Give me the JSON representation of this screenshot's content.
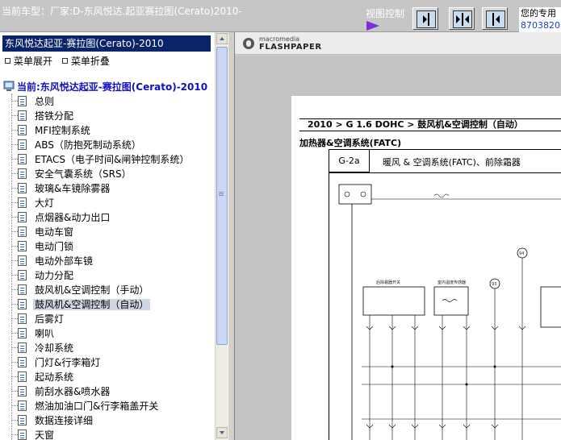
{
  "top_bar": {
    "title": "当前车型：厂家:D-东风悦达.起亚赛拉图(Cerato)2010-",
    "view_control_label": "视图控制",
    "right_info_line1": "您的专用",
    "right_info_line2": "8703820"
  },
  "left_panel": {
    "header": "东风悦达起亚-赛拉图(Cerato)-2010",
    "expand_label": "菜单展开",
    "collapse_label": "菜单折叠",
    "tree_root": "当前:东风悦达起亚-赛拉图(Cerato)-2010",
    "items": [
      {
        "label": "总则"
      },
      {
        "label": "搭铁分配"
      },
      {
        "label": "MFI控制系统"
      },
      {
        "label": "ABS（防抱死制动系统）"
      },
      {
        "label": "ETACS（电子时间&闸钟控制系统）"
      },
      {
        "label": "安全气囊系统（SRS）"
      },
      {
        "label": "玻璃&车镜除雾器"
      },
      {
        "label": "大灯"
      },
      {
        "label": "点烟器&动力出口"
      },
      {
        "label": "电动车窗"
      },
      {
        "label": "电动门锁"
      },
      {
        "label": "电动外部车镜"
      },
      {
        "label": "动力分配"
      },
      {
        "label": "鼓风机&空调控制（手动）"
      },
      {
        "label": "鼓风机&空调控制（自动）",
        "selected": true
      },
      {
        "label": "后雾灯"
      },
      {
        "label": "喇叭"
      },
      {
        "label": "冷却系统"
      },
      {
        "label": "门灯&行李箱灯"
      },
      {
        "label": "起动系统"
      },
      {
        "label": "前刮水器&喷水器"
      },
      {
        "label": "燃油加油口门&行李箱盖开关"
      },
      {
        "label": "数据连接详细"
      },
      {
        "label": "天窗"
      }
    ]
  },
  "viewer": {
    "brand_small": "macromedia",
    "brand_big": "FLASHPAPER",
    "breadcrumb": "2010 > G 1.6 DOHC > 鼓风机&空调控制（自动）",
    "section_title": "加热器&空调系统(FATC)",
    "diagram_code": "G-2a",
    "diagram_title": "暖风 & 空调系统(FATC)、前除霜器",
    "diagram_labels": {
      "box1": "后除霜器开关",
      "box2": "室内温度传感器",
      "callout93": "93",
      "callout94": "94"
    }
  },
  "colors": {
    "header_bg": "#0a246a",
    "selected_bg": "#cfd6e4",
    "root_text": "#1010c0",
    "arrow_accent": "#7b2fd8"
  }
}
